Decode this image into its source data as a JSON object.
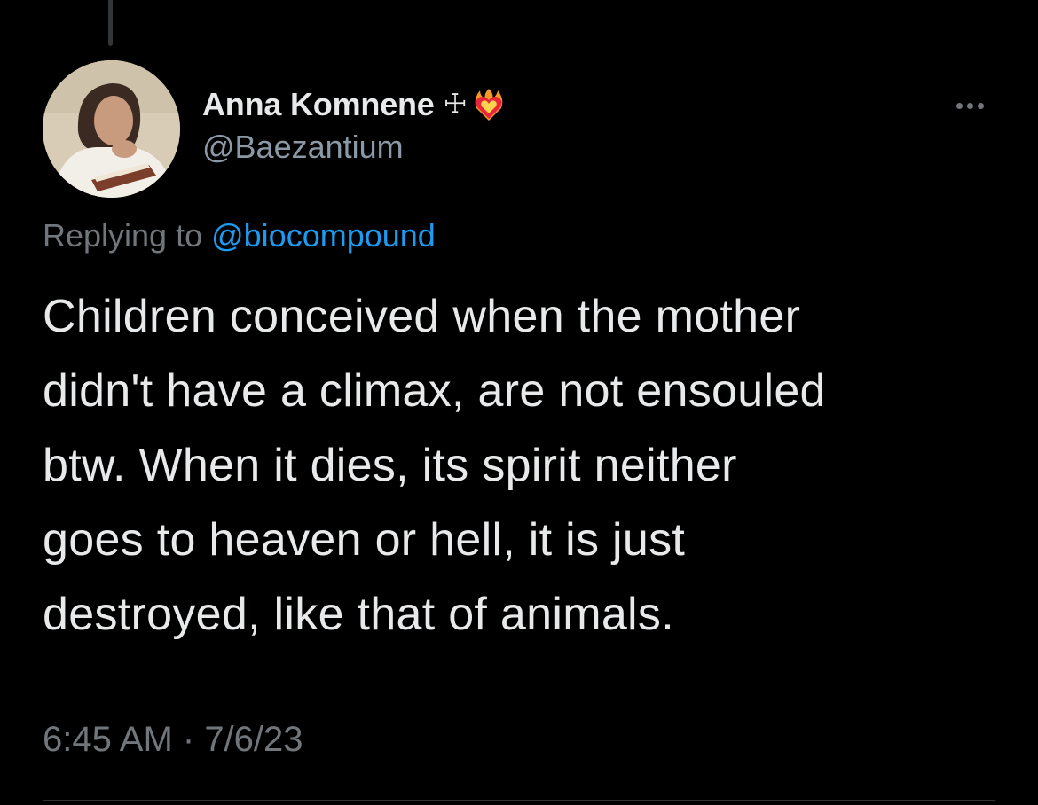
{
  "tweet": {
    "author": {
      "display_name": "Anna Komnene",
      "name_emoji": [
        "cross-icon",
        "heart-on-fire-icon"
      ],
      "handle": "@Baezantium"
    },
    "reply": {
      "prefix": "Replying to ",
      "mention": "@biocompound"
    },
    "text": "Children conceived when the mother\ndidn't have a climax, are not ensouled\nbtw. When it dies, its spirit neither\ngoes to heaven or hell, it is just\ndestroyed, like that of animals.",
    "time": "6:45 AM",
    "separator": " · ",
    "date": "7/6/23"
  },
  "colors": {
    "background": "#000000",
    "primary_text": "#e7e9ea",
    "secondary_text": "#71767b",
    "link": "#1d9bf0"
  }
}
